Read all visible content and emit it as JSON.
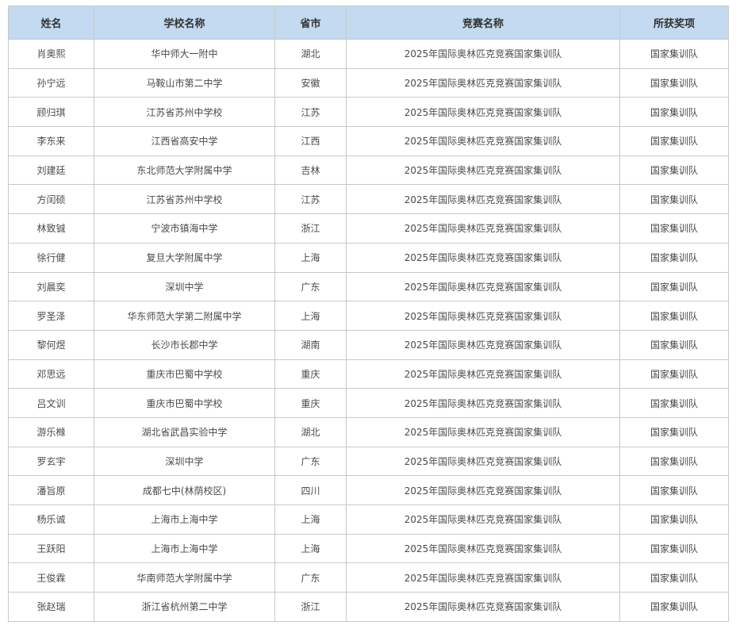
{
  "table": {
    "headers": [
      "姓名",
      "学校名称",
      "省市",
      "竞赛名称",
      "所获奖项"
    ],
    "rows": [
      [
        "肖奥熙",
        "华中师大一附中",
        "湖北",
        "2025年国际奥林匹克竞赛国家集训队",
        "国家集训队"
      ],
      [
        "孙宁远",
        "马鞍山市第二中学",
        "安徽",
        "2025年国际奥林匹克竞赛国家集训队",
        "国家集训队"
      ],
      [
        "顾归琪",
        "江苏省苏州中学校",
        "江苏",
        "2025年国际奥林匹克竞赛国家集训队",
        "国家集训队"
      ],
      [
        "李东来",
        "江西省高安中学",
        "江西",
        "2025年国际奥林匹克竞赛国家集训队",
        "国家集训队"
      ],
      [
        "刘建廷",
        "东北师范大学附属中学",
        "吉林",
        "2025年国际奥林匹克竞赛国家集训队",
        "国家集训队"
      ],
      [
        "方闰硕",
        "江苏省苏州中学校",
        "江苏",
        "2025年国际奥林匹克竞赛国家集训队",
        "国家集训队"
      ],
      [
        "林致铖",
        "宁波市镇海中学",
        "浙江",
        "2025年国际奥林匹克竞赛国家集训队",
        "国家集训队"
      ],
      [
        "徐行健",
        "复旦大学附属中学",
        "上海",
        "2025年国际奥林匹克竞赛国家集训队",
        "国家集训队"
      ],
      [
        "刘晨奕",
        "深圳中学",
        "广东",
        "2025年国际奥林匹克竞赛国家集训队",
        "国家集训队"
      ],
      [
        "罗圣泽",
        "华东师范大学第二附属中学",
        "上海",
        "2025年国际奥林匹克竞赛国家集训队",
        "国家集训队"
      ],
      [
        "黎何煜",
        "长沙市长郡中学",
        "湖南",
        "2025年国际奥林匹克竞赛国家集训队",
        "国家集训队"
      ],
      [
        "邓思远",
        "重庆市巴蜀中学校",
        "重庆",
        "2025年国际奥林匹克竞赛国家集训队",
        "国家集训队"
      ],
      [
        "吕文训",
        "重庆市巴蜀中学校",
        "重庆",
        "2025年国际奥林匹克竞赛国家集训队",
        "国家集训队"
      ],
      [
        "游乐橼",
        "湖北省武昌实验中学",
        "湖北",
        "2025年国际奥林匹克竞赛国家集训队",
        "国家集训队"
      ],
      [
        "罗玄宇",
        "深圳中学",
        "广东",
        "2025年国际奥林匹克竞赛国家集训队",
        "国家集训队"
      ],
      [
        "潘旨原",
        "成都七中(林荫校区)",
        "四川",
        "2025年国际奥林匹克竞赛国家集训队",
        "国家集训队"
      ],
      [
        "杨乐诚",
        "上海市上海中学",
        "上海",
        "2025年国际奥林匹克竞赛国家集训队",
        "国家集训队"
      ],
      [
        "王跃阳",
        "上海市上海中学",
        "上海",
        "2025年国际奥林匹克竞赛国家集训队",
        "国家集训队"
      ],
      [
        "王俊霖",
        "华南师范大学附属中学",
        "广东",
        "2025年国际奥林匹克竞赛国家集训队",
        "国家集训队"
      ],
      [
        "张赵瑞",
        "浙江省杭州第二中学",
        "浙江",
        "2025年国际奥林匹克竞赛国家集训队",
        "国家集训队"
      ]
    ]
  },
  "colors": {
    "header_background": "#c3daf0",
    "border": "#c9c9c9",
    "header_text": "#333333",
    "body_text": "#4a4a4a"
  }
}
